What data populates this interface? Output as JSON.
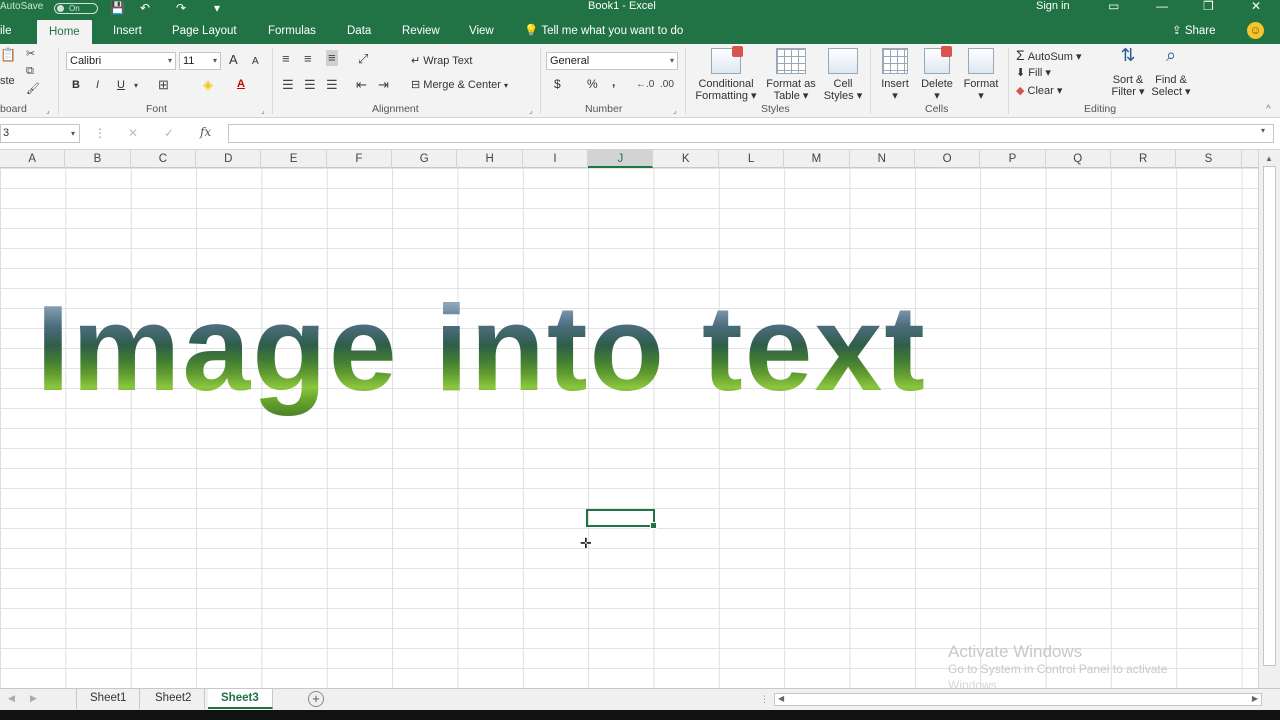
{
  "titlebar": {
    "autosave_label": "AutoSave",
    "autosave_state": "On",
    "save_icon": "💾",
    "undo_icon": "↶",
    "redo_icon": "↷",
    "customize_icon": "▾",
    "document_title": "Book1 - Excel",
    "sign_in": "Sign in",
    "ribbon_display_icon": "▭",
    "minimize_icon": "—",
    "restore_icon": "❐",
    "close_icon": "✕"
  },
  "tabs": [
    {
      "label": "ile"
    },
    {
      "label": "Home"
    },
    {
      "label": "Insert"
    },
    {
      "label": "Page Layout"
    },
    {
      "label": "Formulas"
    },
    {
      "label": "Data"
    },
    {
      "label": "Review"
    },
    {
      "label": "View"
    }
  ],
  "tell_me": "Tell me what you want to do",
  "share": "Share",
  "ribbon": {
    "clipboard": {
      "paste_label": "ste",
      "group": "board"
    },
    "font": {
      "name": "Calibri",
      "size": "11",
      "grow": "A",
      "shrink": "A",
      "bold": "B",
      "italic": "I",
      "underline": "U",
      "font_color_glyph": "A",
      "group": "Font"
    },
    "alignment": {
      "wrap_text": "Wrap Text",
      "merge_center": "Merge & Center",
      "group": "Alignment"
    },
    "number": {
      "format": "General",
      "currency": "$",
      "percent": "%",
      "comma": ",",
      "group": "Number"
    },
    "styles": {
      "conditional": [
        "Conditional",
        "Formatting"
      ],
      "format_as_table": [
        "Format as",
        "Table"
      ],
      "cell_styles": [
        "Cell",
        "Styles"
      ],
      "group": "Styles"
    },
    "cells": {
      "insert": "Insert",
      "delete": "Delete",
      "format": "Format",
      "group": "Cells"
    },
    "editing": {
      "autosum": "AutoSum",
      "fill": "Fill",
      "clear": "Clear",
      "sort_filter": [
        "Sort &",
        "Filter"
      ],
      "find_select": [
        "Find &",
        "Select"
      ],
      "group": "Editing"
    }
  },
  "formula_bar": {
    "name_box": "3",
    "cancel": "✕",
    "enter": "✓",
    "fx": "fx",
    "value": ""
  },
  "columns": [
    "A",
    "B",
    "C",
    "D",
    "E",
    "F",
    "G",
    "H",
    "I",
    "J",
    "K",
    "L",
    "M",
    "N",
    "O",
    "P",
    "Q",
    "R",
    "S"
  ],
  "selected_column": "J",
  "art_text": "Image into text",
  "watermark": {
    "line1": "Activate Windows",
    "line2": "Go to System in Control Panel to activate",
    "line3": "Windows"
  },
  "sheets": [
    {
      "label": "Sheet1",
      "active": false
    },
    {
      "label": "Sheet2",
      "active": false
    },
    {
      "label": "Sheet3",
      "active": true
    }
  ],
  "add_sheet": "+",
  "colors": {
    "accent": "#217346",
    "ribbon_bg": "#f3f3f3"
  }
}
